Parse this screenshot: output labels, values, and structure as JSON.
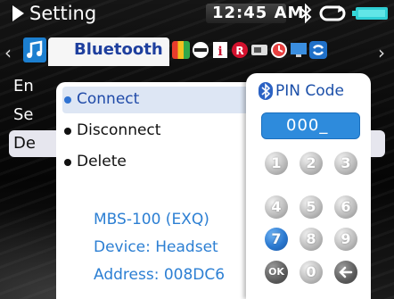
{
  "status_bar": {
    "title": "Setting",
    "time": "12:45 AM"
  },
  "tabs": {
    "active_label": "Bluetooth",
    "icons": [
      "music-icon",
      "display-icon",
      "storage-icon",
      "info-icon",
      "record-icon",
      "card-icon",
      "clock-icon",
      "screen-icon",
      "refresh-icon"
    ]
  },
  "background_list": {
    "items": [
      "En",
      "Se",
      "De"
    ]
  },
  "option_menu": {
    "items": [
      {
        "label": "Connect",
        "selected": true
      },
      {
        "label": "Disconnect",
        "selected": false
      },
      {
        "label": "Delete",
        "selected": false
      }
    ],
    "device_name": "MBS-100 (EXQ)",
    "device_type": "Device: Headset",
    "device_address": "Address: 008DC6"
  },
  "pin_dialog": {
    "title": "PIN Code",
    "value": "000_",
    "keys": [
      "1",
      "2",
      "3",
      "4",
      "5",
      "6",
      "7",
      "8",
      "9",
      "OK",
      "0",
      "back"
    ],
    "active_key": "7"
  },
  "colors": {
    "accent": "#2e8bdc",
    "highlight": "#dde6f4",
    "info_text": "#2c7fd3"
  }
}
